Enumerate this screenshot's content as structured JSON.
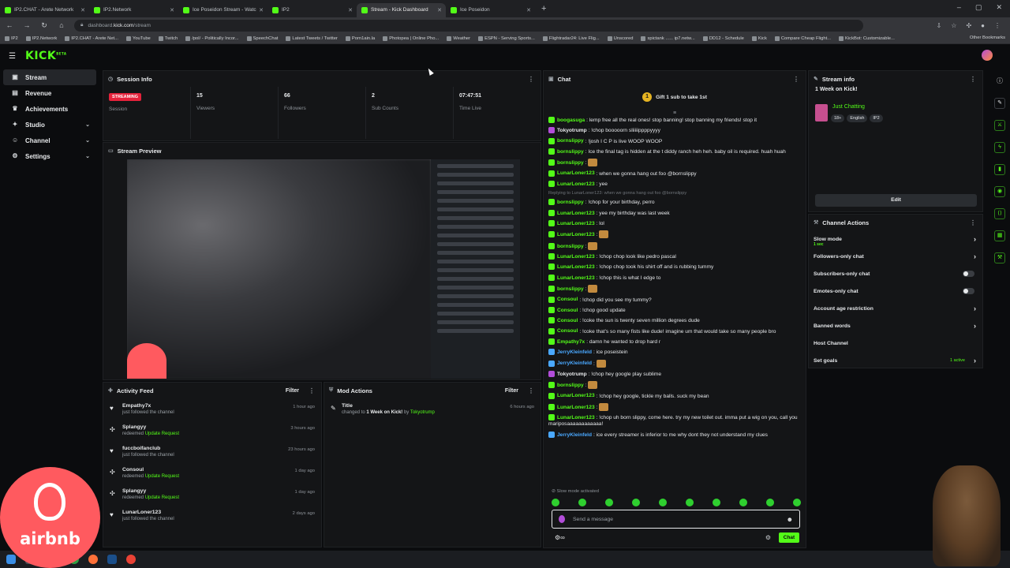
{
  "browser": {
    "tabs": [
      {
        "label": "IP2.CHAT - Arete Network",
        "active": false
      },
      {
        "label": "IP2.Network",
        "active": false
      },
      {
        "label": "Ice Poseidon Stream - Watc",
        "active": false
      },
      {
        "label": "IP2",
        "active": false
      },
      {
        "label": "Stream - Kick Dashboard",
        "active": true
      },
      {
        "label": "Ice Poseidon",
        "active": false
      }
    ],
    "url_prefix": "dashboard.",
    "url_domain": "kick.com",
    "url_path": "/stream",
    "bookmarks": [
      "IP2",
      "IP2.Network",
      "IP2.CHAT - Arete Net...",
      "YouTube",
      "Twitch",
      "/pol/ - Politically Incor...",
      "SpeechChat",
      "Latest Tweets / Twitter",
      "Porn1ain.la",
      "Photopea | Online Pho...",
      "Weather",
      "ESPN - Serving Sports...",
      "Flightradar24: Live Flig...",
      "Unscored",
      "spictank ...... ip7.netw...",
      "DD12 - Schedule",
      "Kick",
      "Compare Cheap Flight...",
      "KickBot: Customizable..."
    ],
    "other_bookmarks": "Other Bookmarks"
  },
  "app": {
    "logo": "KICK",
    "logo_sup": "BETA"
  },
  "sidebar": {
    "items": [
      {
        "label": "Stream",
        "icon": "video-icon",
        "active": true,
        "chevron": false
      },
      {
        "label": "Revenue",
        "icon": "wallet-icon",
        "active": false,
        "chevron": false
      },
      {
        "label": "Achievements",
        "icon": "trophy-icon",
        "active": false,
        "chevron": false
      },
      {
        "label": "Studio",
        "icon": "studio-icon",
        "active": false,
        "chevron": true
      },
      {
        "label": "Channel",
        "icon": "person-icon",
        "active": false,
        "chevron": true
      },
      {
        "label": "Settings",
        "icon": "gear-icon",
        "active": false,
        "chevron": true
      }
    ]
  },
  "session": {
    "title": "Session Info",
    "status": "STREAMING",
    "status_label": "Session",
    "stats": [
      {
        "value": "15",
        "label": "Viewers"
      },
      {
        "value": "66",
        "label": "Followers"
      },
      {
        "value": "2",
        "label": "Sub Counts"
      },
      {
        "value": "07:47:51",
        "label": "Time Live"
      }
    ]
  },
  "preview": {
    "title": "Stream Preview"
  },
  "activity": {
    "title": "Activity Feed",
    "filter": "Filter",
    "items": [
      {
        "name": "Empathy7x",
        "action": "just followed the channel",
        "highlight": "",
        "time": "1 hour ago",
        "icon": "heart-icon"
      },
      {
        "name": "Splangyy",
        "action": "redeemed",
        "highlight": "Update Request",
        "time": "3 hours ago",
        "icon": "redeem-icon"
      },
      {
        "name": "fuccboifanclub",
        "action": "just followed the channel",
        "highlight": "",
        "time": "23 hours ago",
        "icon": "heart-icon"
      },
      {
        "name": "Consoul",
        "action": "redeemed",
        "highlight": "Update Request",
        "time": "1 day ago",
        "icon": "redeem-icon"
      },
      {
        "name": "Splangyy",
        "action": "redeemed",
        "highlight": "Update Request",
        "time": "1 day ago",
        "icon": "redeem-icon"
      },
      {
        "name": "LunarLoner123",
        "action": "just followed the channel",
        "highlight": "",
        "time": "2 days ago",
        "icon": "heart-icon"
      }
    ]
  },
  "mod": {
    "title": "Mod Actions",
    "filter": "Filter",
    "item_title": "Title",
    "item_text_prefix": "changed to",
    "item_value": "1 Week on Kick!",
    "item_by": "by",
    "item_user": "Tokyotrump",
    "item_time": "6 hours ago"
  },
  "chat": {
    "title": "Chat",
    "gift": "Gift 1 sub to take 1st",
    "messages": [
      {
        "user": "boogasuga",
        "color": "#53fc18",
        "text": ": lemp free all the real ones! stop banning! stop banning my friends! stop it"
      },
      {
        "user": "Tokyotrump",
        "color": "#e8eaec",
        "text": ": !chop booooorn sliiiiippppyyyy"
      },
      {
        "user": "bornslippy",
        "color": "#53fc18",
        "text": ": !josh I C P is live WOOP WOOP"
      },
      {
        "user": "bornslippy",
        "color": "#53fc18",
        "text": ": Ice the final tag is hidden at the t diddy ranch heh heh. baby oil is required. huah huah"
      },
      {
        "user": "bornslippy",
        "color": "#53fc18",
        "text": ": "
      },
      {
        "user": "LunarLoner123",
        "color": "#53fc18",
        "text": ": when we gonna hang out foo @bornslippy"
      },
      {
        "user": "LunarLoner123",
        "color": "#53fc18",
        "text": ": yee"
      },
      {
        "user": "bornslippy",
        "color": "#53fc18",
        "text": ": !chop for your birthday, perro",
        "reply": "Replying to LunarLoner123: when we gonna hang out foo @bornslippy"
      },
      {
        "user": "LunarLoner123",
        "color": "#53fc18",
        "text": ": yee my birthday was last week"
      },
      {
        "user": "LunarLoner123",
        "color": "#53fc18",
        "text": ": lol"
      },
      {
        "user": "LunarLoner123",
        "color": "#53fc18",
        "text": ": "
      },
      {
        "user": "bornslippy",
        "color": "#53fc18",
        "text": ": "
      },
      {
        "user": "LunarLoner123",
        "color": "#53fc18",
        "text": ": !chop chop look like pedro pascal"
      },
      {
        "user": "LunarLoner123",
        "color": "#53fc18",
        "text": ": !chop chop took his shirt off and is rubbing tummy"
      },
      {
        "user": "LunarLoner123",
        "color": "#53fc18",
        "text": ": !chop this is what I edge to"
      },
      {
        "user": "bornslippy",
        "color": "#53fc18",
        "text": ": "
      },
      {
        "user": "Consoul",
        "color": "#53fc18",
        "text": ": !chop did you see my tummy?"
      },
      {
        "user": "Consoul",
        "color": "#53fc18",
        "text": ": !chop good update"
      },
      {
        "user": "Consoul",
        "color": "#53fc18",
        "text": ": !coke the sun is twenty seven million degrees dude"
      },
      {
        "user": "Consoul",
        "color": "#53fc18",
        "text": ": !coke that's so many fists like dude! imagine um that would take so many people bro"
      },
      {
        "user": "Empathy7x",
        "color": "#53fc18",
        "text": ": damn he wanted to drop hard r"
      },
      {
        "user": "JerryKleinfeld",
        "color": "#4aa8ff",
        "text": ": ice poseistein"
      },
      {
        "user": "JerryKleinfeld",
        "color": "#4aa8ff",
        "text": ": "
      },
      {
        "user": "Tokyotrump",
        "color": "#e8eaec",
        "text": ": !chop hey google play sublime"
      },
      {
        "user": "bornslippy",
        "color": "#53fc18",
        "text": ": "
      },
      {
        "user": "LunarLoner123",
        "color": "#53fc18",
        "text": ": !chop hey google, tickle my balls. suck my bean"
      },
      {
        "user": "LunarLoner123",
        "color": "#53fc18",
        "text": ": "
      },
      {
        "user": "LunarLoner123",
        "color": "#53fc18",
        "text": ": !chop uh born slippy, come here. try my new toilet out. imma put a wig on you, call you mariposaaaaaaaaaaaa!"
      },
      {
        "user": "JerryKleinfeld",
        "color": "#4aa8ff",
        "text": ": ice every streamer is inferior to me why dont they not understand my clues"
      }
    ],
    "slow_mode": "Slow mode activated",
    "placeholder": "Send a message",
    "send": "Chat"
  },
  "stream_info": {
    "title": "Stream info",
    "stream_title": "1 Week on Kick!",
    "category": "Just Chatting",
    "tags": [
      "18+",
      "English",
      "IP2"
    ],
    "edit": "Edit"
  },
  "channel_actions": {
    "title": "Channel Actions",
    "rows": [
      {
        "label": "Slow mode",
        "sub": "1 sec",
        "control": "chevron"
      },
      {
        "label": "Followers-only chat",
        "sub": "",
        "control": "chevron"
      },
      {
        "label": "Subscribers-only chat",
        "sub": "",
        "control": "toggle"
      },
      {
        "label": "Emotes-only chat",
        "sub": "",
        "control": "toggle"
      },
      {
        "label": "Account age restriction",
        "sub": "",
        "control": "chevron"
      },
      {
        "label": "Banned words",
        "sub": "",
        "control": "chevron"
      },
      {
        "label": "Host Channel",
        "sub": "",
        "control": "none"
      },
      {
        "label": "Set goals",
        "sub": "",
        "control": "chevron",
        "extra": "1 active"
      }
    ]
  },
  "overlay": {
    "airbnb": "airbnb"
  },
  "colors": {
    "brand": "#53fc18",
    "live": "#e5223b",
    "bg": "#0b0c0e",
    "panel": "#141517"
  }
}
